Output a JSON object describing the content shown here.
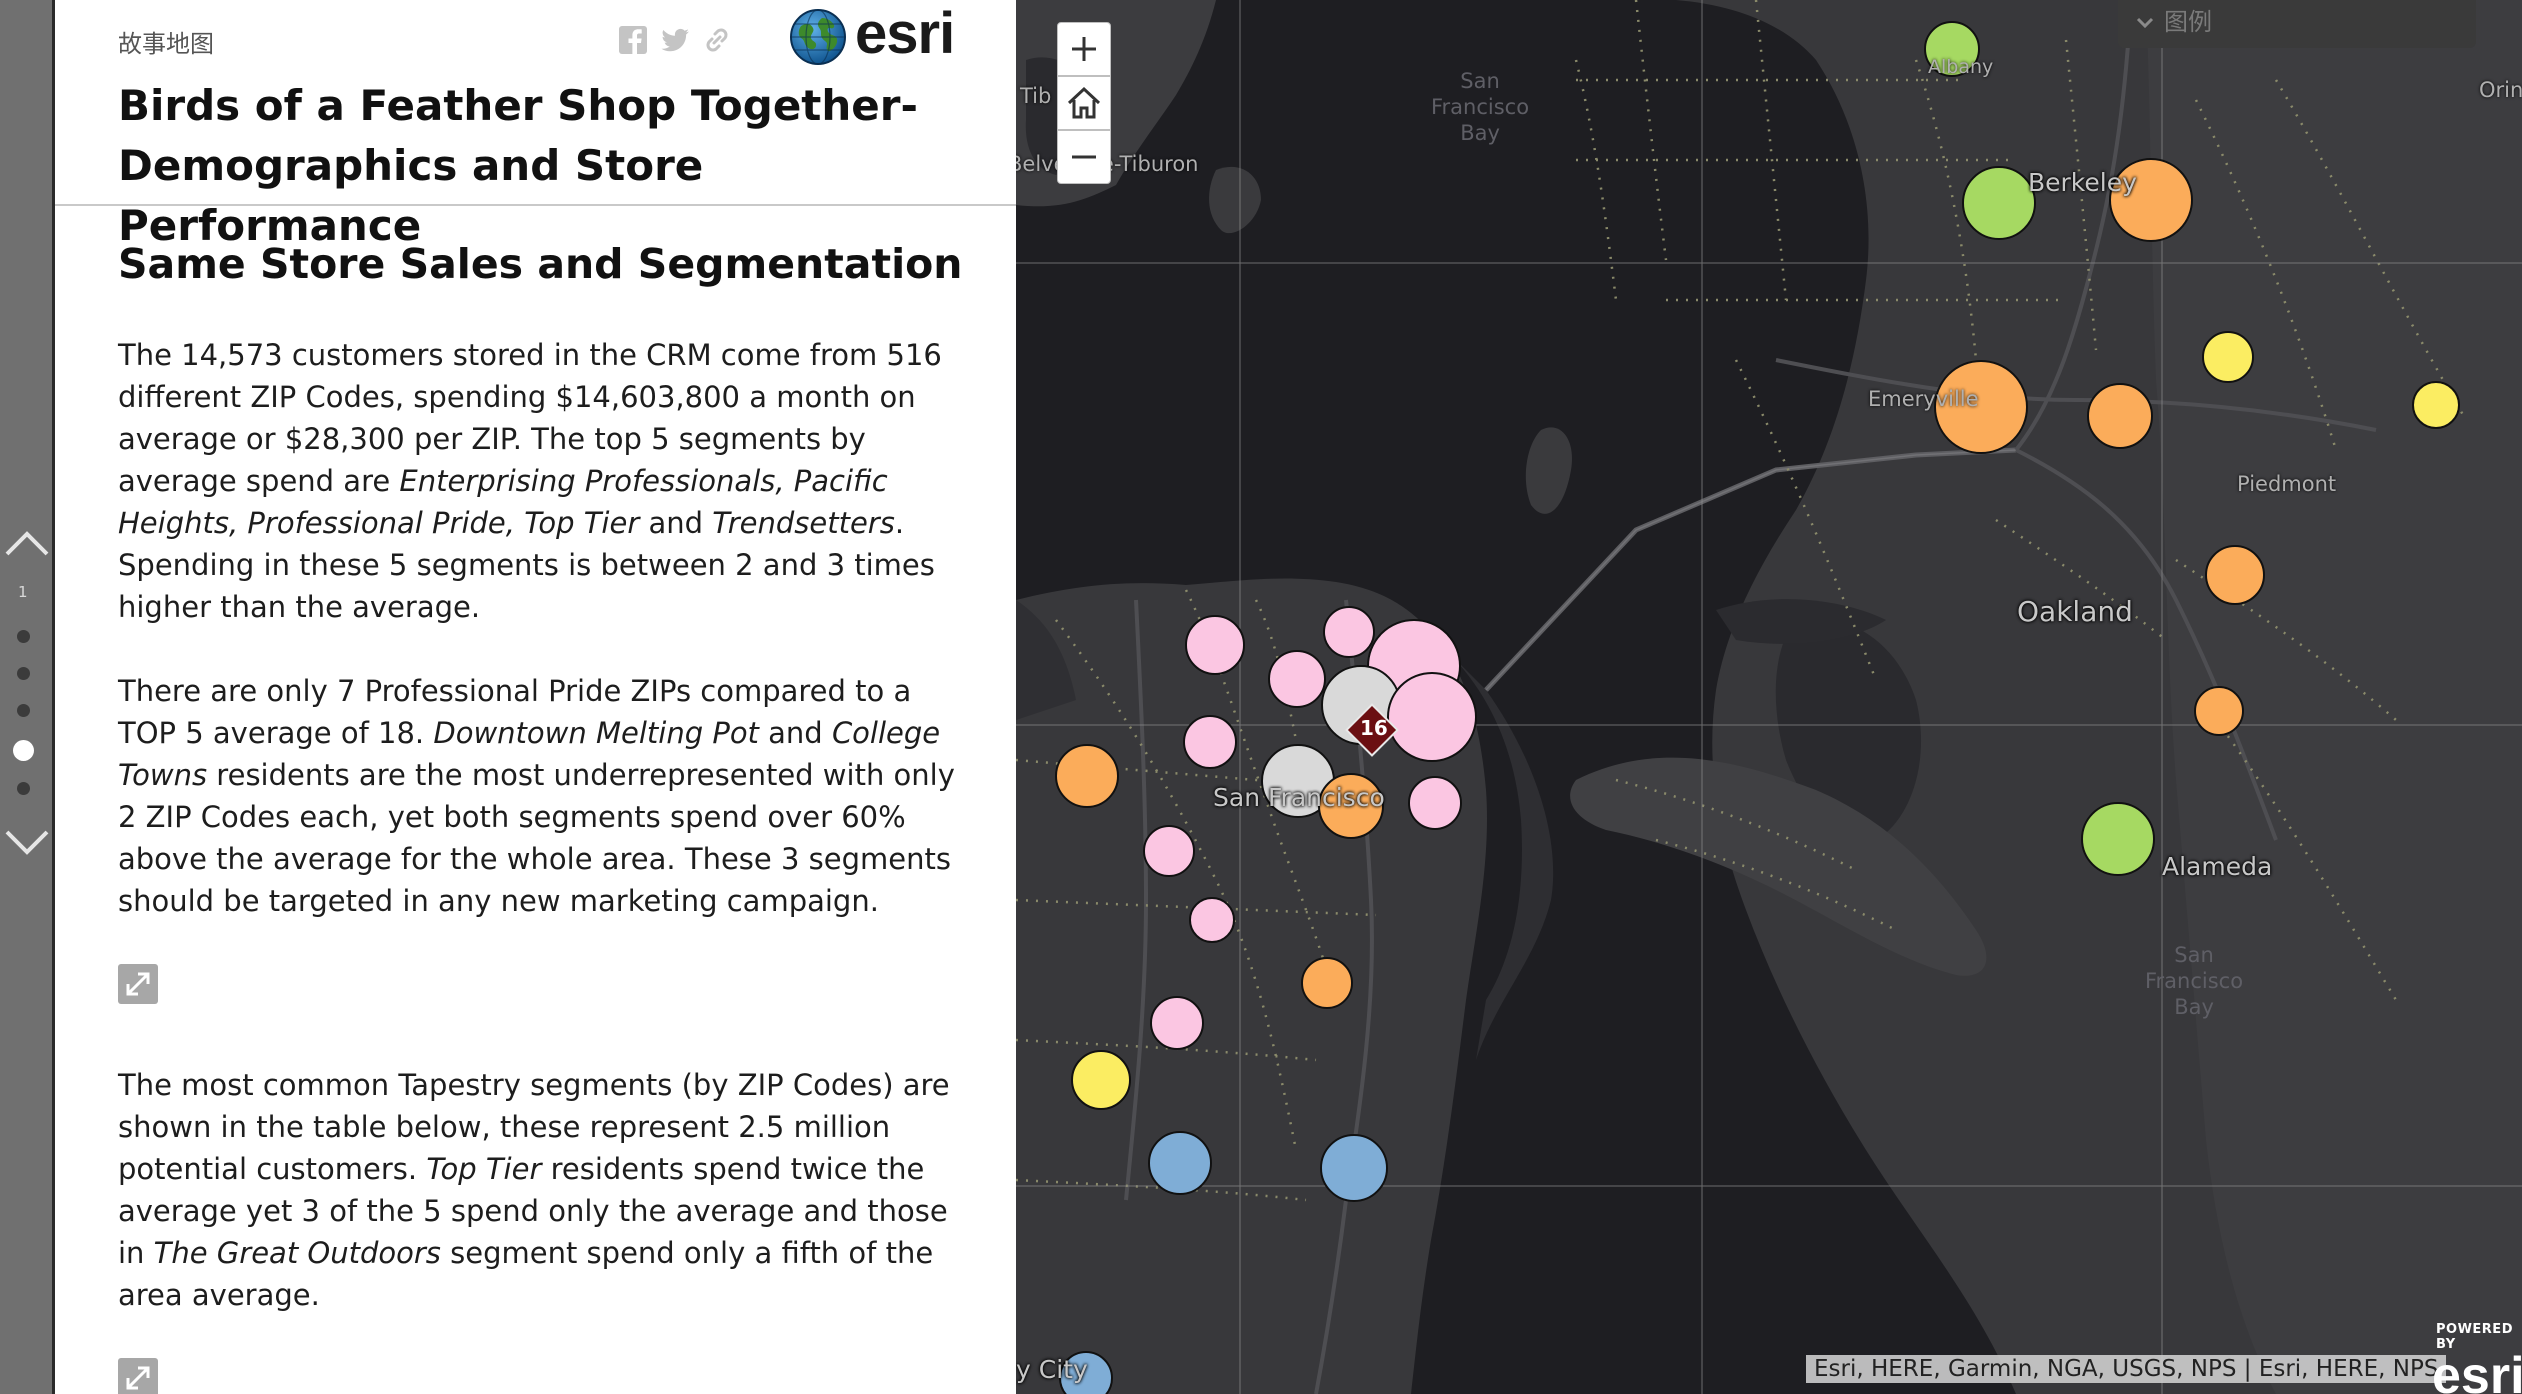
{
  "nav": {
    "current_page": "1"
  },
  "header": {
    "subtitle": "故事地图",
    "brand": "esri",
    "title": "Birds of a Feather Shop Together- Demographics and Store Performance"
  },
  "section": {
    "title": "Same Store Sales and Segmentation",
    "p1": {
      "a": "The 14,573 customers stored in the CRM come from 516 different ZIP Codes, spending $14,603,800 a month on average or $28,300 per ZIP. The top 5 segments by average spend are ",
      "b": "Enterprising Professionals, Pacific Heights, Professional Pride, Top Tier",
      "c": " and ",
      "d": "Trendsetters",
      "e": ". Spending in these 5 segments is between 2 and 3 times higher than the average."
    },
    "p2": {
      "a": "There are only 7 Professional Pride ZIPs compared to a TOP 5 average of 18. ",
      "b": "Downtown Melting Pot",
      "c": " and ",
      "d": "College Towns",
      "e": " residents are the most underrepresented with only 2 ZIP Codes each, yet both segments spend over 60% above the average for the whole area. These 3 segments should be targeted in any new marketing campaign."
    },
    "p3": {
      "a": "The most common Tapestry segments (by ZIP Codes) are shown in the table below, these represent 2.5 million potential customers. ",
      "b": "Top Tier",
      "c": " residents spend twice the average yet 3 of the 5 spend only the average and those in ",
      "d": "The Great Outdoors",
      "e": " segment spend only a fifth of the area average."
    }
  },
  "map": {
    "legend_label": "图例",
    "zoom_in": "+",
    "zoom_out": "−",
    "cluster_count": "16",
    "labels": {
      "sf_bay_north": "San\nFrancisco\nBay",
      "sf_bay_south": "San\nFrancisco\nBay",
      "tiburon": "Belvedere-Tiburon",
      "tib": "Tib",
      "albany": "Albany",
      "berkeley": "Berkeley",
      "emeryville": "Emeryville",
      "piedmont": "Piedmont",
      "oakland": "Oakland",
      "alameda": "Alameda",
      "san_francisco": "San Francisco",
      "daly_city": "y City",
      "orinda": "Orin"
    },
    "attribution": "Esri, HERE, Garmin, NGA, USGS, NPS | Esri, HERE, NPS",
    "powered_by": "POWERED BY",
    "powered_brand": "esri",
    "colors": {
      "green": "#a6d962",
      "orange": "#fbac5a",
      "yellow": "#fbed62",
      "pink": "#fbc6e2",
      "gray": "#d9d9d9",
      "blue": "#7fadd6",
      "cluster": "#6b0f12"
    }
  }
}
